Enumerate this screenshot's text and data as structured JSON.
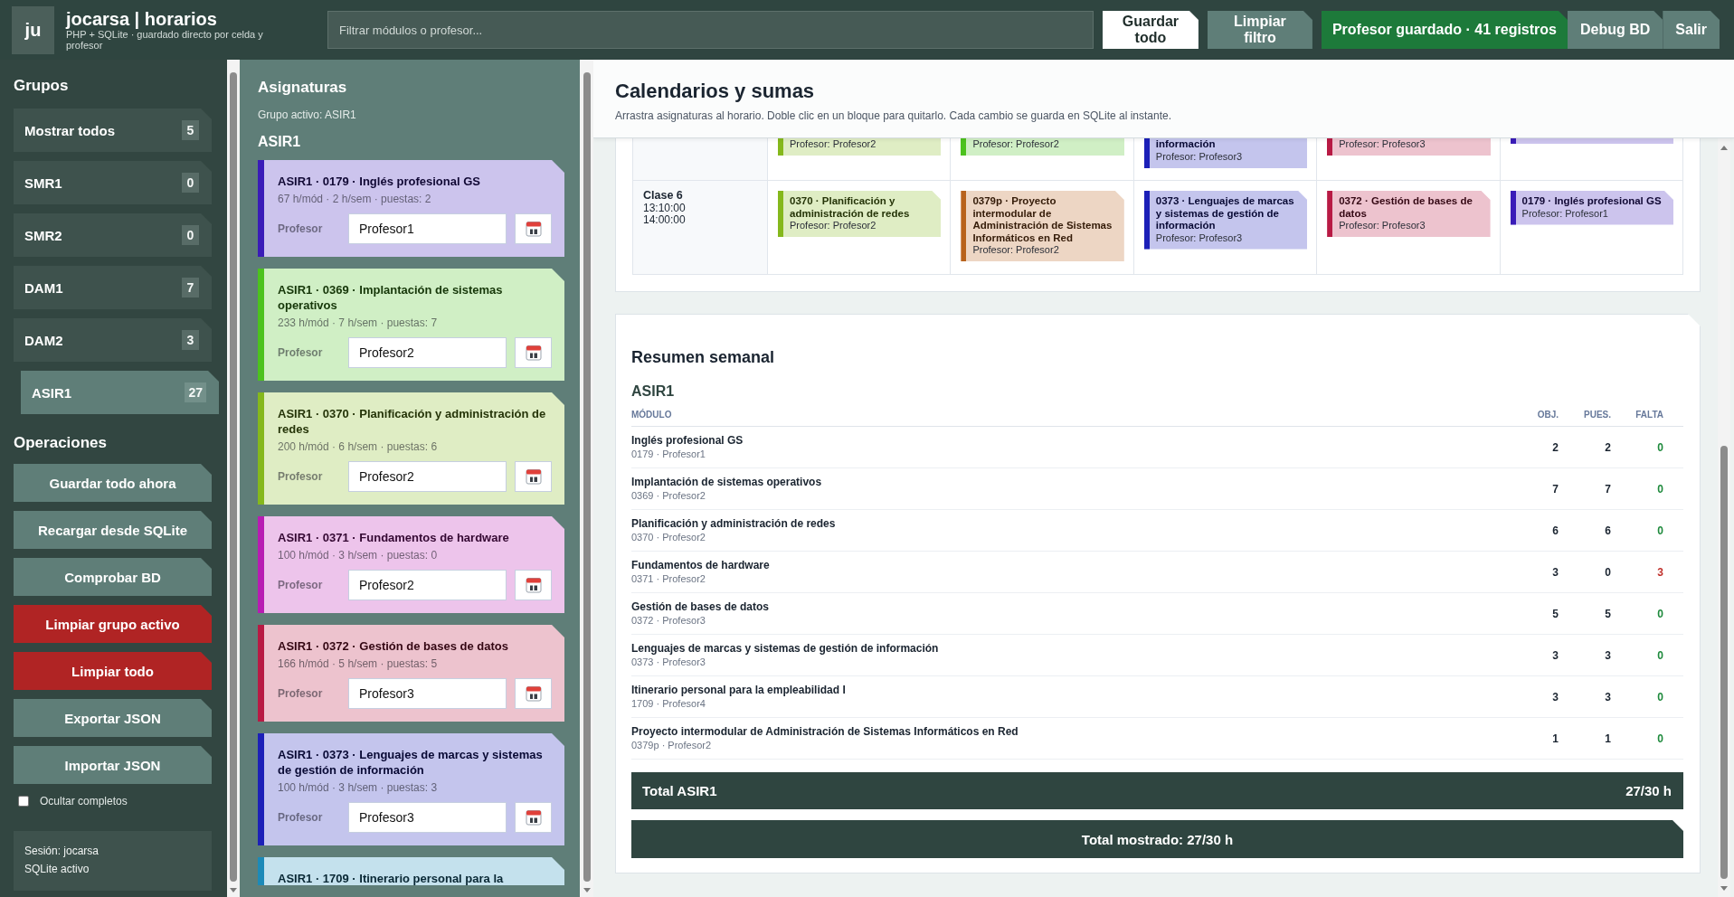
{
  "topbar": {
    "logo": "ju",
    "title": "jocarsa | horarios",
    "subtitle": "PHP + SQLite · guardado directo por celda y profesor",
    "search": {
      "placeholder": "Filtrar módulos o profesor..."
    },
    "actions": [
      {
        "label": "Guardar todo",
        "kind": "primary"
      },
      {
        "label": "Limpiar filtro",
        "kind": "secondary"
      },
      {
        "label": "Profesor guardado · 41 registros",
        "kind": "status"
      },
      {
        "label": "Debug BD",
        "kind": "secondary"
      },
      {
        "label": "Salir",
        "kind": "secondary"
      }
    ]
  },
  "sidebar": {
    "groups_title": "Grupos",
    "groups": [
      {
        "label": "Mostrar todos",
        "count": "5",
        "selected": false
      },
      {
        "label": "SMR1",
        "count": "0",
        "selected": false
      },
      {
        "label": "SMR2",
        "count": "0",
        "selected": false
      },
      {
        "label": "DAM1",
        "count": "7",
        "selected": false
      },
      {
        "label": "DAM2",
        "count": "3",
        "selected": false
      },
      {
        "label": "ASIR1",
        "count": "27",
        "selected": true
      }
    ],
    "operations_title": "Operaciones",
    "operations": [
      {
        "label": "Guardar todo ahora",
        "kind": "default"
      },
      {
        "label": "Recargar desde SQLite",
        "kind": "default"
      },
      {
        "label": "Comprobar BD",
        "kind": "default"
      },
      {
        "label": "Limpiar grupo activo",
        "kind": "danger"
      },
      {
        "label": "Limpiar todo",
        "kind": "danger"
      },
      {
        "label": "Exportar JSON",
        "kind": "default"
      },
      {
        "label": "Importar JSON",
        "kind": "default"
      }
    ],
    "hide_complete": {
      "label": "Ocultar completos",
      "checked": false
    },
    "session": [
      "Sesión: jocarsa",
      "SQLite activo"
    ]
  },
  "subjects": {
    "title": "Asignaturas",
    "active_group": "Grupo activo: ASIR1",
    "group": "ASIR1",
    "items": [
      {
        "title": "ASIR1 · 0179 · Inglés profesional GS",
        "meta": "67 h/mód · 2 h/sem · puestas: 2",
        "teacher_label": "Profesor",
        "teacher": "Profesor1",
        "color": "#3a1cb8"
      },
      {
        "title": "ASIR1 · 0369 · Implantación de sistemas operativos",
        "meta": "233 h/mód · 7 h/sem · puestas: 7",
        "teacher_label": "Profesor",
        "teacher": "Profesor2",
        "color": "#4cc21e"
      },
      {
        "title": "ASIR1 · 0370 · Planificación y administración de redes",
        "meta": "200 h/mód · 6 h/sem · puestas: 6",
        "teacher_label": "Profesor",
        "teacher": "Profesor2",
        "color": "#85b81c"
      },
      {
        "title": "ASIR1 · 0371 · Fundamentos de hardware",
        "meta": "100 h/mód · 3 h/sem · puestas: 0",
        "teacher_label": "Profesor",
        "teacher": "Profesor2",
        "color": "#b81cb3"
      },
      {
        "title": "ASIR1 · 0372 · Gestión de bases de datos",
        "meta": "166 h/mód · 5 h/sem · puestas: 5",
        "teacher_label": "Profesor",
        "teacher": "Profesor3",
        "color": "#b81a44"
      },
      {
        "title": "ASIR1 · 0373 · Lenguajes de marcas y sistemas de gestión de información",
        "meta": "100 h/mód · 3 h/sem · puestas: 3",
        "teacher_label": "Profesor",
        "teacher": "Profesor3",
        "color": "#1c20b8"
      },
      {
        "title": "ASIR1 · 1709 · Itinerario personal para la",
        "color": "#1c8ab8"
      }
    ]
  },
  "calendar": {
    "title": "Calendarios y sumas",
    "hint": "Arrastra asignaturas al horario. Doble clic en un bloque para quitarlo. Cada cambio se guarda en SQLite al instante.",
    "rows": [
      {
        "partial": true,
        "cells": [
          {
            "blocks": [
              {
                "teacher": "Profesor: Profesor2",
                "color": "#85b81c"
              }
            ]
          },
          {
            "blocks": [
              {
                "teacher": "Profesor: Profesor2",
                "color": "#4cc21e"
              }
            ]
          },
          {
            "blocks": [
              {
                "title": "información",
                "teacher": "Profesor: Profesor3",
                "color": "#1c20b8"
              }
            ]
          },
          {
            "blocks": [
              {
                "teacher": "Profesor: Profesor3",
                "color": "#b81a44"
              }
            ]
          },
          {
            "blocks": [
              {
                "color": "#3a1cb8"
              }
            ]
          }
        ]
      },
      {
        "partial": false,
        "label": "Clase 6",
        "start": "13:10:00",
        "end": "14:00:00",
        "cells": [
          {
            "blocks": [
              {
                "title": "0370 · Planificación y administración de redes",
                "teacher": "Profesor: Profesor2",
                "color": "#85b81c"
              }
            ]
          },
          {
            "blocks": [
              {
                "title": "0379p · Proyecto intermodular de Administración de Sistemas Informáticos en Red",
                "teacher": "Profesor: Profesor2",
                "color": "#b8621c"
              }
            ]
          },
          {
            "blocks": [
              {
                "title": "0373 · Lenguajes de marcas y sistemas de gestión de información",
                "teacher": "Profesor: Profesor3",
                "color": "#1c20b8"
              }
            ]
          },
          {
            "blocks": [
              {
                "title": "0372 · Gestión de bases de datos",
                "teacher": "Profesor: Profesor3",
                "color": "#b81a44"
              }
            ]
          },
          {
            "blocks": [
              {
                "title": "0179 · Inglés profesional GS",
                "teacher": "Profesor: Profesor1",
                "color": "#3a1cb8"
              }
            ]
          }
        ]
      }
    ]
  },
  "summary": {
    "title": "Resumen semanal",
    "group": "ASIR1",
    "columns": [
      "MÓDULO",
      "OBJ.",
      "PUES.",
      "FALTA"
    ],
    "rows": [
      {
        "name": "Inglés profesional GS",
        "detail": "0179 · Profesor1",
        "target": "2",
        "placed": "2",
        "missing": "0",
        "complete": true
      },
      {
        "name": "Implantación de sistemas operativos",
        "detail": "0369 · Profesor2",
        "target": "7",
        "placed": "7",
        "missing": "0",
        "complete": true
      },
      {
        "name": "Planificación y administración de redes",
        "detail": "0370 · Profesor2",
        "target": "6",
        "placed": "6",
        "missing": "0",
        "complete": true
      },
      {
        "name": "Fundamentos de hardware",
        "detail": "0371 · Profesor2",
        "target": "3",
        "placed": "0",
        "missing": "3",
        "complete": false
      },
      {
        "name": "Gestión de bases de datos",
        "detail": "0372 · Profesor3",
        "target": "5",
        "placed": "5",
        "missing": "0",
        "complete": true
      },
      {
        "name": "Lenguajes de marcas y sistemas de gestión de información",
        "detail": "0373 · Profesor3",
        "target": "3",
        "placed": "3",
        "missing": "0",
        "complete": true
      },
      {
        "name": "Itinerario personal para la empleabilidad I",
        "detail": "1709 · Profesor4",
        "target": "3",
        "placed": "3",
        "missing": "0",
        "complete": true
      },
      {
        "name": "Proyecto intermodular de Administración de Sistemas Informáticos en Red",
        "detail": "0379p · Profesor2",
        "target": "1",
        "placed": "1",
        "missing": "0",
        "complete": true
      }
    ],
    "total": {
      "label": "Total ASIR1",
      "value": "27/30 h"
    },
    "shown_total": "Total mostrado: 27/30 h"
  }
}
